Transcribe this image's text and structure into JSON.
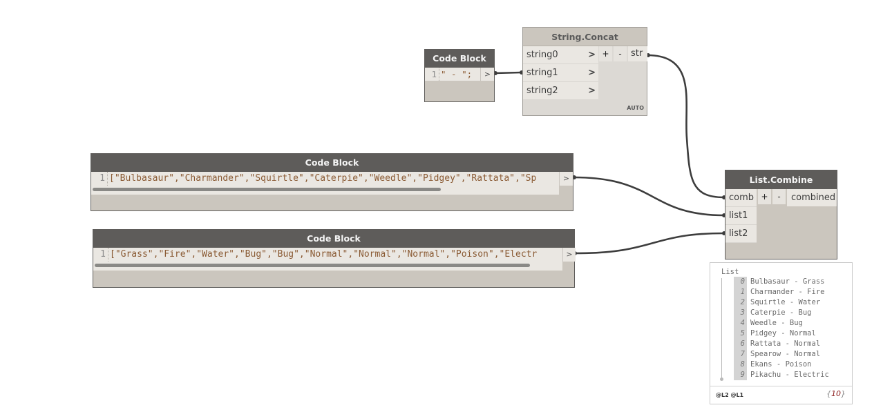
{
  "colors": {
    "canvas": "#ffffff",
    "node_header": "#5e5c5a",
    "node_body": "#cbc6be",
    "wire": "#3d3d3d",
    "code_text": "#8a5a33",
    "count_text": "#8b1a1a"
  },
  "nodes": {
    "separator_code_block": {
      "title": "Code Block",
      "line_number": "1",
      "code": "\" - \";",
      "output_button": ">"
    },
    "string_concat": {
      "title": "String.Concat",
      "inputs": [
        "string0",
        "string1",
        "string2"
      ],
      "input_chevron": ">",
      "add_label": "+",
      "remove_label": "-",
      "output": "str",
      "lacing": "AUTO"
    },
    "names_code_block": {
      "title": "Code Block",
      "line_number": "1",
      "code": "[\"Bulbasaur\",\"Charmander\",\"Squirtle\",\"Caterpie\",\"Weedle\",\"Pidgey\",\"Rattata\",\"Sp",
      "output_button": ">"
    },
    "types_code_block": {
      "title": "Code Block",
      "line_number": "1",
      "code": "[\"Grass\",\"Fire\",\"Water\",\"Bug\",\"Bug\",\"Normal\",\"Normal\",\"Normal\",\"Poison\",\"Electr",
      "output_button": ">"
    },
    "list_combine": {
      "title": "List.Combine",
      "inputs": [
        "comb",
        "list1",
        "list2"
      ],
      "add_label": "+",
      "remove_label": "-",
      "output": "combined"
    }
  },
  "watch": {
    "title": "List",
    "items": [
      {
        "index": "0",
        "value": "Bulbasaur - Grass"
      },
      {
        "index": "1",
        "value": "Charmander - Fire"
      },
      {
        "index": "2",
        "value": "Squirtle - Water"
      },
      {
        "index": "3",
        "value": "Caterpie - Bug"
      },
      {
        "index": "4",
        "value": "Weedle - Bug"
      },
      {
        "index": "5",
        "value": "Pidgey - Normal"
      },
      {
        "index": "6",
        "value": "Rattata - Normal"
      },
      {
        "index": "7",
        "value": "Spearow - Normal"
      },
      {
        "index": "8",
        "value": "Ekans - Poison"
      },
      {
        "index": "9",
        "value": "Pikachu - Electric"
      }
    ],
    "levels": "@L2 @L1",
    "count_open": "{",
    "count": "10",
    "count_close": "}"
  }
}
